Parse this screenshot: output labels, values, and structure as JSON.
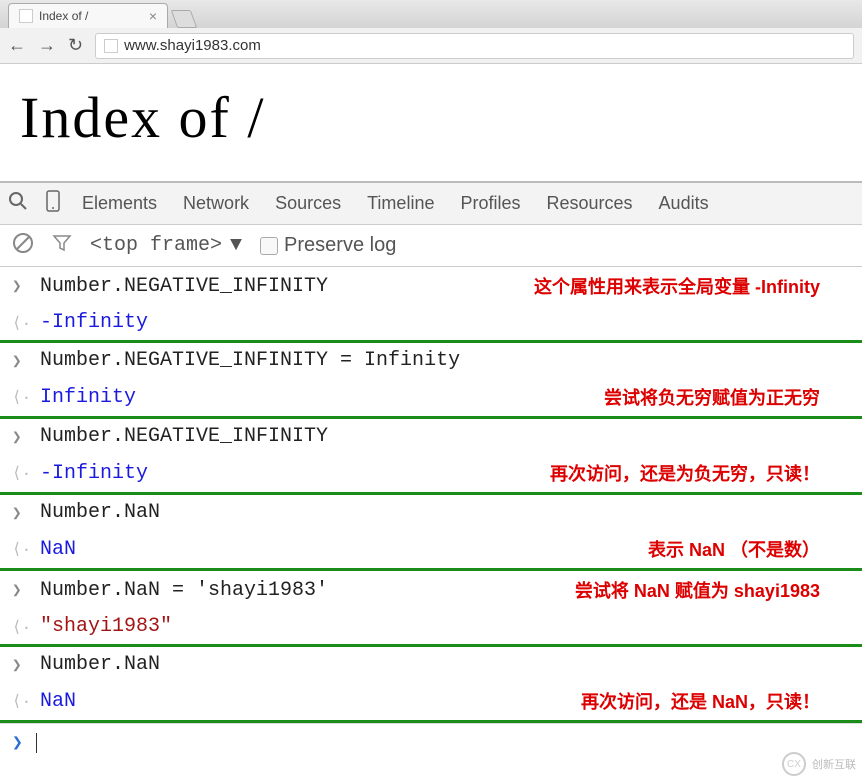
{
  "browser": {
    "tab_title": "Index of /",
    "url": "www.shayi1983.com"
  },
  "page": {
    "heading": "Index of /"
  },
  "devtools": {
    "tabs": [
      "Elements",
      "Network",
      "Sources",
      "Timeline",
      "Profiles",
      "Resources",
      "Audits"
    ],
    "frame_label": "<top frame>",
    "preserve_label": "Preserve log"
  },
  "console": {
    "groups": [
      {
        "input": "Number.NEGATIVE_INFINITY",
        "output": "-Infinity",
        "output_class": "result-blue",
        "annotation": "这个属性用来表示全局变量 -Infinity"
      },
      {
        "input": "Number.NEGATIVE_INFINITY = Infinity",
        "output": "Infinity",
        "output_class": "result-blue",
        "annotation": "尝试将负无穷赋值为正无穷"
      },
      {
        "input": "Number.NEGATIVE_INFINITY",
        "output": "-Infinity",
        "output_class": "result-blue",
        "annotation": "再次访问，还是为负无穷，只读！"
      },
      {
        "input": "Number.NaN",
        "output": "NaN",
        "output_class": "result-blue",
        "annotation": "表示 NaN （不是数）"
      },
      {
        "input": "Number.NaN = 'shayi1983'",
        "output": "\"shayi1983\"",
        "output_class": "result-string",
        "annotation": "尝试将 NaN 赋值为 shayi1983"
      },
      {
        "input": "Number.NaN",
        "output": "NaN",
        "output_class": "result-blue",
        "annotation": "再次访问，还是 NaN，只读！"
      }
    ]
  },
  "watermark": {
    "logo": "CX",
    "text": "创新互联"
  }
}
